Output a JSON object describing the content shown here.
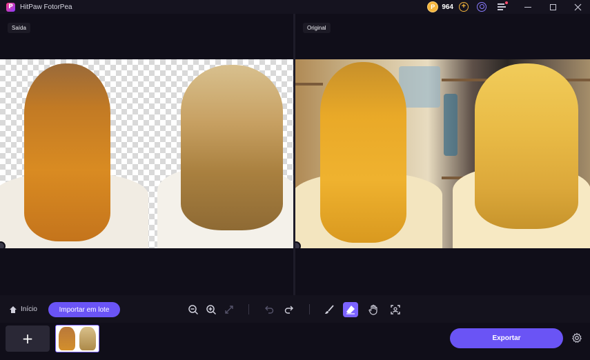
{
  "app": {
    "title": "HitPaw FotorPea",
    "logo_letter": "P"
  },
  "header": {
    "coin_symbol": "P",
    "credits": "964",
    "add_credits_symbol": "+"
  },
  "panels": {
    "output_label": "Saída",
    "original_label": "Original"
  },
  "toolbar": {
    "home_label": "Início",
    "batch_import_label": "Importar em lote"
  },
  "bottom": {
    "add_symbol": "+",
    "export_label": "Exportar"
  },
  "colors": {
    "accent": "#6a54f5",
    "accent_active": "#7b63ff",
    "background": "#100e19",
    "toolbar": "#14121d",
    "coin": "#f3b43b"
  },
  "icons": [
    "home-icon",
    "zoom-out-icon",
    "zoom-in-icon",
    "fit-screen-icon",
    "undo-icon",
    "redo-icon",
    "brush-icon",
    "eraser-icon",
    "hand-icon",
    "scan-icon",
    "gear-icon",
    "user-icon",
    "menu-icon"
  ]
}
